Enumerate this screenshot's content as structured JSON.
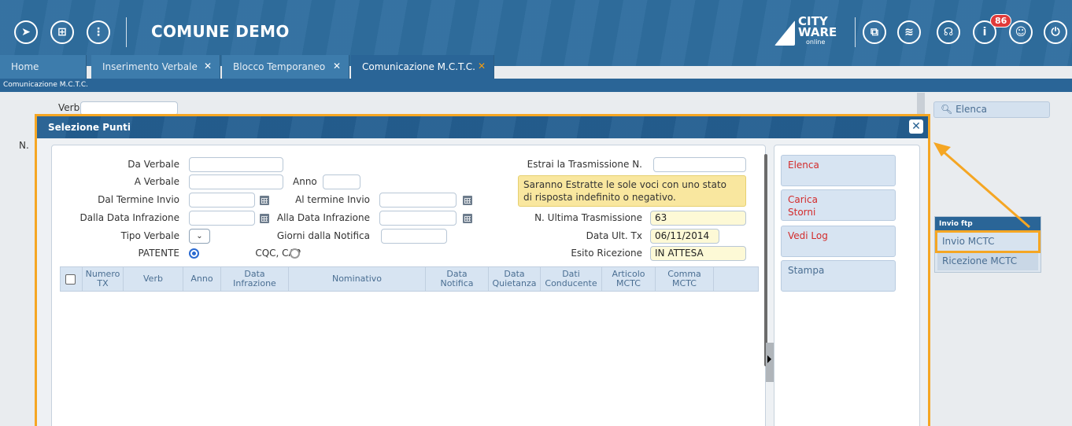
{
  "header": {
    "title": "COMUNE DEMO",
    "logo": {
      "line1": "CITY",
      "line2": "WARE",
      "line3": "online"
    },
    "notification_count": "86"
  },
  "tabs": [
    {
      "label": "Home"
    },
    {
      "label": "Inserimento Verbale"
    },
    {
      "label": "Blocco Temporaneo"
    },
    {
      "label": "Comunicazione M.C.T.C."
    }
  ],
  "breadcrumb": "Comunicazione M.C.T.C.",
  "background": {
    "verbale_label": "Verbale",
    "n_label": "N.",
    "right_elenca": "Elenca",
    "ftp_panel": {
      "title": "Invio ftp",
      "items": [
        "Invio MCTC",
        "Ricezione MCTC"
      ]
    }
  },
  "modal": {
    "title": "Selezione Punti",
    "form": {
      "da_verbale": "Da Verbale",
      "a_verbale": "A Verbale",
      "anno": "Anno",
      "dal_termine_invio": "Dal Termine Invio",
      "al_termine_invio": "Al termine Invio",
      "dalla_data_infrazione": "Dalla Data Infrazione",
      "alla_data_infrazione": "Alla Data Infrazione",
      "tipo_verbale": "Tipo Verbale",
      "giorni_dalla_notifica": "Giorni dalla Notifica",
      "patente": "PATENTE",
      "cqc_cap": "CQC, CAP",
      "estrai_trasmissione": "Estrai la Trasmissione N.",
      "note_line1": "Saranno Estratte le sole voci con uno stato",
      "note_line2": "di risposta indefinito o negativo.",
      "n_ultima_trasmissione": "N. Ultima Trasmissione",
      "n_ultima_trasmissione_value": "63",
      "data_ult_tx": "Data Ult. Tx",
      "data_ult_tx_value": "06/11/2014",
      "esito_ricezione": "Esito Ricezione",
      "esito_ricezione_value": "IN ATTESA"
    },
    "grid_columns": [
      {
        "line1": "Numero",
        "line2": "TX"
      },
      {
        "line1": "Verb",
        "line2": ""
      },
      {
        "line1": "Anno",
        "line2": ""
      },
      {
        "line1": "Data",
        "line2": "Infrazione"
      },
      {
        "line1": "Nominativo",
        "line2": ""
      },
      {
        "line1": "Data",
        "line2": "Notifica"
      },
      {
        "line1": "Data",
        "line2": "Quietanza"
      },
      {
        "line1": "Dati",
        "line2": "Conducente"
      },
      {
        "line1": "Articolo",
        "line2": "MCTC"
      },
      {
        "line1": "Comma",
        "line2": "MCTC"
      }
    ],
    "side_buttons": [
      {
        "label": "Elenca"
      },
      {
        "label": "Carica\nStorni"
      },
      {
        "label": "Vedi Log"
      },
      {
        "label": "Stampa"
      }
    ]
  },
  "colors": {
    "header_blue": "#2f6e9f",
    "highlight_orange": "#f5a623",
    "button_red_text": "#d32b2b"
  }
}
